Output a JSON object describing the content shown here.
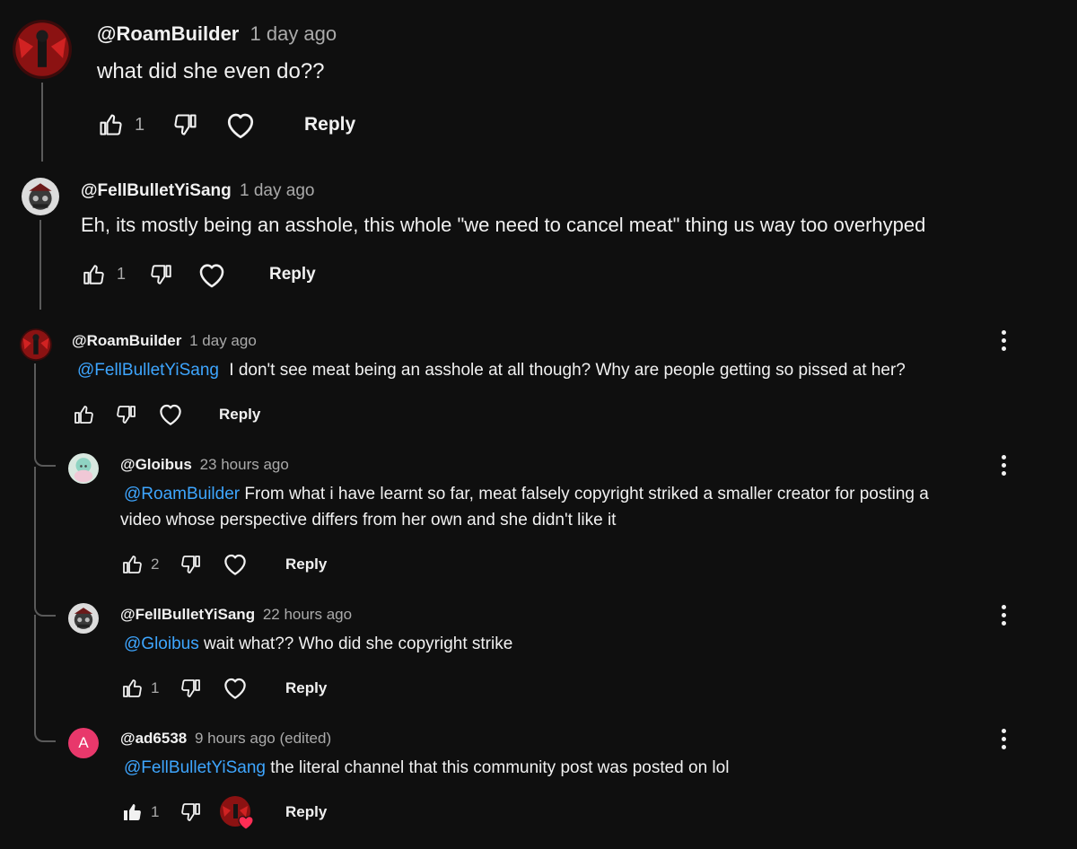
{
  "comments": [
    {
      "author": "@RoamBuilder",
      "time": "1 day ago",
      "text": "what did she even do??",
      "likes": "1",
      "reply_label": "Reply"
    },
    {
      "author": "@FellBulletYiSang",
      "time": "1 day ago",
      "text": "Eh, its mostly being an asshole, this whole \"we need to cancel meat\" thing us way too overhyped",
      "likes": "1",
      "reply_label": "Reply"
    },
    {
      "author": "@RoamBuilder",
      "time": "1 day ago",
      "mention": "@FellBulletYiSang",
      "text": "I don't see meat being an asshole at all though? Why are people getting so pissed at her?",
      "reply_label": "Reply"
    },
    {
      "author": "@Gloibus",
      "time": "23 hours ago",
      "mention": "@RoamBuilder",
      "text_line1": "From what i have learnt so far, meat falsely copyright striked a smaller creator for posting a",
      "text_line2": "video whose perspective differs from her own and she didn't like it",
      "likes": "2",
      "reply_label": "Reply"
    },
    {
      "author": "@FellBulletYiSang",
      "time": "22 hours ago",
      "mention": "@Gloibus",
      "text": "wait what?? Who did she copyright strike",
      "likes": "1",
      "reply_label": "Reply"
    },
    {
      "author": "@ad6538",
      "time": "9 hours ago (edited)",
      "avatar_letter": "A",
      "mention": "@FellBulletYiSang",
      "text": "the literal channel that this community post was posted on lol",
      "likes": "1",
      "reply_label": "Reply"
    }
  ],
  "colors": {
    "background": "#0f0f0f",
    "mention": "#3ea6ff",
    "secondary_text": "#aaaaaa",
    "avatar_a": "#e8386b",
    "heart_badge": "#ff2d55"
  },
  "icons": [
    "thumbs-up-icon",
    "thumbs-down-icon",
    "heart-icon",
    "more-vert-icon",
    "creator-heart-avatar-icon"
  ]
}
